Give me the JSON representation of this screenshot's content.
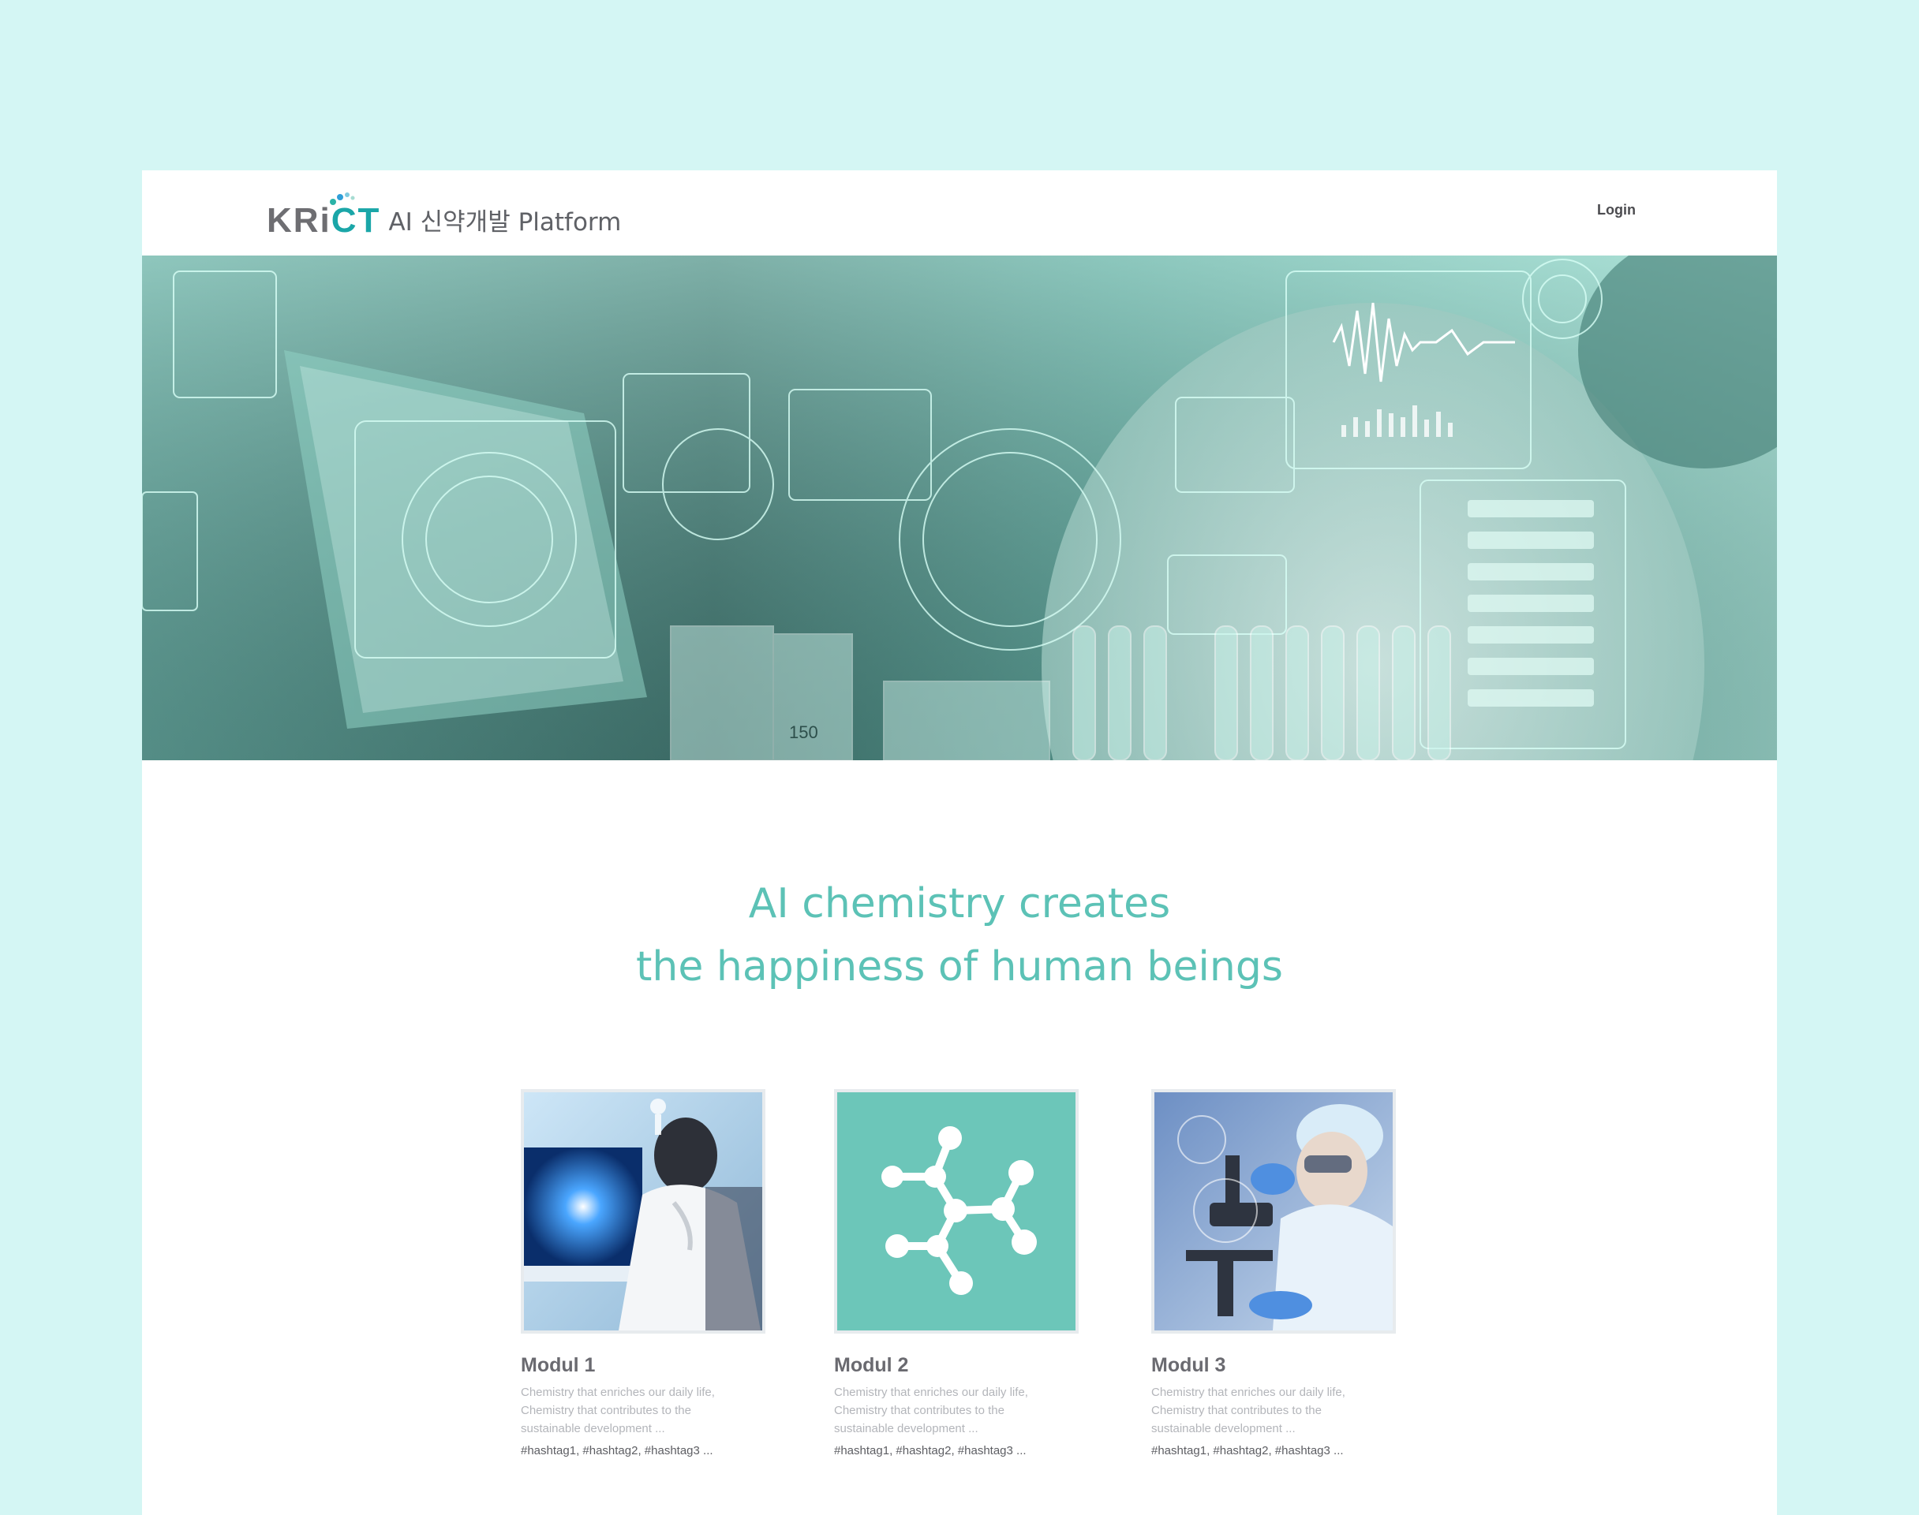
{
  "header": {
    "logo_letters_1": "KRi",
    "logo_letters_2": "CT",
    "logo_subtitle": "AI 신약개발 Platform",
    "login_label": "Login"
  },
  "hero": {
    "image_desc_icon": "lab-scientist-hologram-image",
    "beaker_label": "150"
  },
  "tagline": {
    "line1": "AI chemistry creates",
    "line2": "the happiness of human beings"
  },
  "cards": [
    {
      "title": "Modul 1",
      "desc": "Chemistry that enriches our daily life, Chemistry that contributes to the sustainable development ...",
      "tags": "#hashtag1,  #hashtag2, #hashtag3 ...",
      "icon": "scientist-computer-image"
    },
    {
      "title": "Modul 2",
      "desc": "Chemistry that enriches our daily life, Chemistry that contributes to the sustainable development ...",
      "tags": "#hashtag1,  #hashtag2, #hashtag3 ...",
      "icon": "molecule-icon"
    },
    {
      "title": "Modul 3",
      "desc": "Chemistry that enriches our daily life, Chemistry that contributes to the sustainable development ...",
      "tags": "#hashtag1,  #hashtag2, #hashtag3 ...",
      "icon": "scientist-microscope-image"
    }
  ],
  "colors": {
    "page_bg": "#d4f6f4",
    "accent": "#5cc2b6",
    "molecule_bg": "#6cc6b9",
    "logo_gray": "#6e6e72",
    "logo_teal": "#1aa6a8"
  }
}
